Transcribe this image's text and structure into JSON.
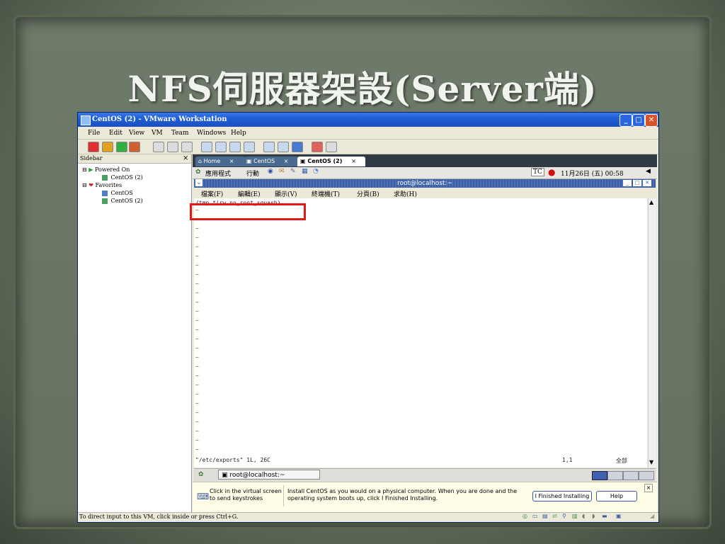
{
  "slide": {
    "title": "NFS伺服器架設(Server端)"
  },
  "window": {
    "title": "CentOS (2) - VMware Workstation",
    "controls": [
      "minimize",
      "maximize",
      "close"
    ]
  },
  "menubar": [
    "File",
    "Edit",
    "View",
    "VM",
    "Team",
    "Windows",
    "Help"
  ],
  "sidebar": {
    "header": "Sidebar",
    "close_label": "×",
    "items": [
      {
        "label": "Powered On"
      },
      {
        "label": "CentOS (2)"
      },
      {
        "label": "Favorites"
      },
      {
        "label": "CentOS"
      },
      {
        "label": "CentOS (2)"
      }
    ]
  },
  "tabs": [
    {
      "label": "Home",
      "close": "×"
    },
    {
      "label": "CentOS",
      "close": "×"
    },
    {
      "label": "CentOS (2)",
      "close": "×"
    }
  ],
  "gnome_panel": {
    "applications": "應用程式",
    "actions": "行動",
    "input_method": "TC",
    "clock": "11月26日 (五)  00:58"
  },
  "terminal": {
    "window_title": "root@localhost:~",
    "menu": [
      "檔案(F)",
      "編輯(E)",
      "顯示(V)",
      "終端機(T)",
      "分頁(B)",
      "求助(H)"
    ],
    "first_line": "/tmp *(rw,no_root_squash)",
    "tilde": "~",
    "status_left": "\"/etc/exports\" 1L, 26C",
    "status_pos": "1,1",
    "status_right": "全部"
  },
  "taskbar": {
    "window_button": "root@localhost:~"
  },
  "hint": {
    "click_text_1": "Click in the virtual screen",
    "click_text_2": "to send keystrokes",
    "install_text_1": "Install CentOS as you would on a physical computer. When you are done and the",
    "install_text_2": "operating system boots up, click I Finished Installing.",
    "finished_button": "I Finished Installing",
    "help_button": "Help",
    "close": "×"
  },
  "statusbar": {
    "text": "To direct input to this VM, click inside or press Ctrl+G."
  },
  "colors": {
    "titlebar": "#1f5fd6",
    "highlight": "#e01818",
    "slide_bg": "#6b7866"
  }
}
